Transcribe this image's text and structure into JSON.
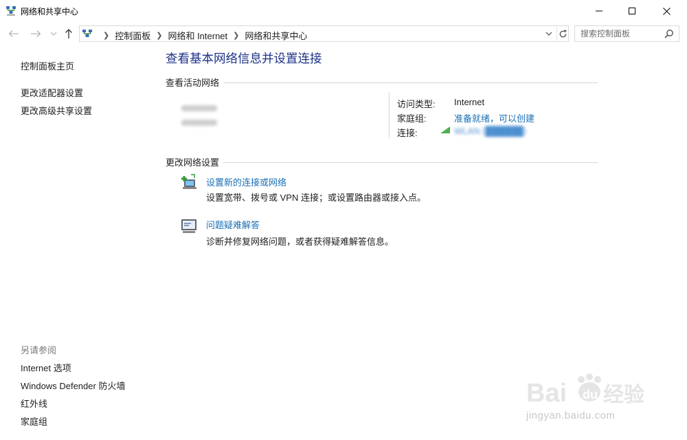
{
  "window": {
    "title": "网络和共享中心",
    "controls": [
      "minimize",
      "maximize",
      "close"
    ]
  },
  "nav": {
    "breadcrumbs": [
      "控制面板",
      "网络和 Internet",
      "网络和共享中心"
    ],
    "search_placeholder": "搜索控制面板"
  },
  "sidebar": {
    "links": [
      "控制面板主页",
      "更改适配器设置",
      "更改高级共享设置"
    ],
    "see_also_title": "另请参阅",
    "see_also": [
      "Internet 选项",
      "Windows Defender 防火墙",
      "红外线",
      "家庭组"
    ]
  },
  "main": {
    "title": "查看基本网络信息并设置连接",
    "active_networks_heading": "查看活动网络",
    "properties": {
      "access_type_label": "访问类型:",
      "access_type_value": "Internet",
      "homegroup_label": "家庭组:",
      "homegroup_value": "准备就绪，可以创建",
      "connections_label": "连接:",
      "connection_value": "WLAN (██████)"
    },
    "change_settings_heading": "更改网络设置",
    "tasks": [
      {
        "icon": "new-connection-icon",
        "title": "设置新的连接或网络",
        "description": "设置宽带、拨号或 VPN 连接；或设置路由器或接入点。"
      },
      {
        "icon": "troubleshoot-icon",
        "title": "问题疑难解答",
        "description": "诊断并修复网络问题，或者获得疑难解答信息。"
      }
    ]
  },
  "watermark": {
    "text": "jingyan.baidu.com"
  },
  "colors": {
    "title_blue": "#1e3287",
    "link_blue": "#1a6fb5",
    "divider": "#d6d6d6"
  }
}
